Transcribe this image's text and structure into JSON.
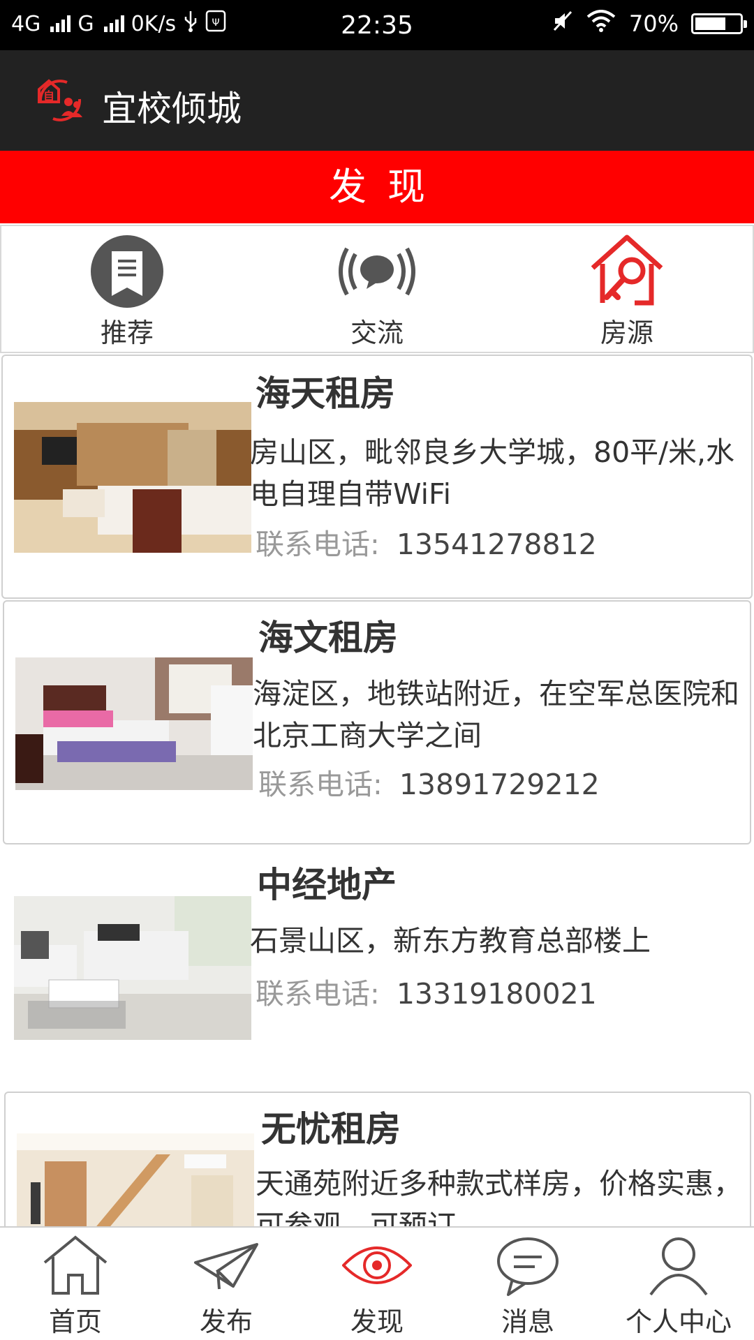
{
  "status_bar": {
    "network": "4G",
    "network2": "G",
    "speed": "0K/s",
    "time": "22:35",
    "battery": "70%",
    "battery_level": 0.7
  },
  "app": {
    "title": "宜校倾城"
  },
  "section": {
    "title": "发现"
  },
  "categories": [
    {
      "label": "推荐",
      "icon": "recommend-icon"
    },
    {
      "label": "交流",
      "icon": "chat-broadcast-icon"
    },
    {
      "label": "房源",
      "icon": "house-key-icon"
    }
  ],
  "listings": [
    {
      "title": "海天租房",
      "description": "房山区，毗邻良乡大学城，80平/米,水电自理自带WiFi",
      "phone_label": "联系电话:",
      "phone": "13541278812"
    },
    {
      "title": "海文租房",
      "description": "海淀区，地铁站附近，在空军总医院和北京工商大学之间",
      "phone_label": "联系电话:",
      "phone": "13891729212"
    },
    {
      "title": "中经地产",
      "description": "石景山区，新东方教育总部楼上",
      "phone_label": "联系电话:",
      "phone": "13319180021"
    },
    {
      "title": "无忧租房",
      "description": "天通苑附近多种款式样房，价格实惠，可参观，可预订"
    }
  ],
  "bottom_nav": [
    {
      "label": "首页",
      "icon": "home-icon"
    },
    {
      "label": "发布",
      "icon": "paper-plane-icon"
    },
    {
      "label": "发现",
      "icon": "eye-icon",
      "active": true
    },
    {
      "label": "消息",
      "icon": "message-icon"
    },
    {
      "label": "个人中心",
      "icon": "user-icon"
    }
  ],
  "colors": {
    "accent": "#ff0000",
    "appbar": "#222222",
    "icon_gray": "#555555"
  }
}
